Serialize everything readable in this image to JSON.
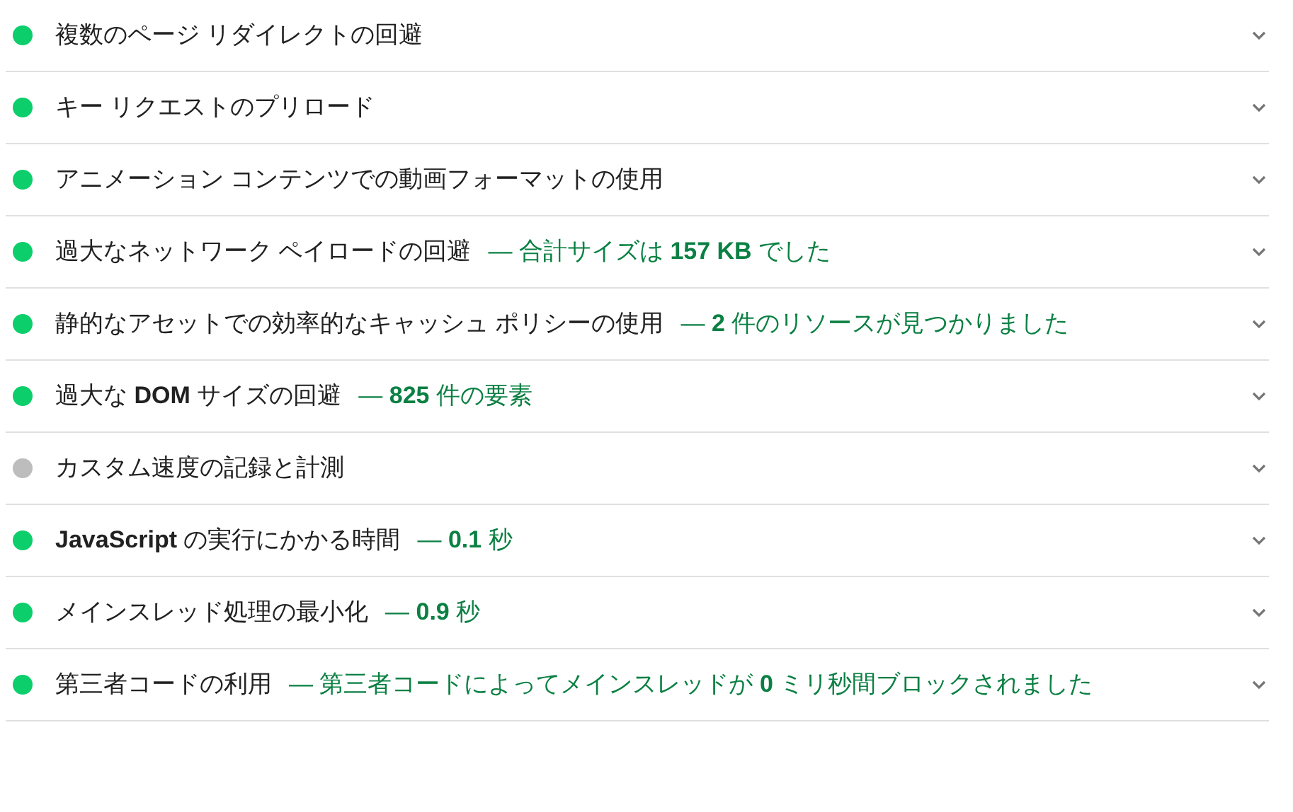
{
  "audits": [
    {
      "title": "複数のページ リダイレクトの回避",
      "color": "#0cce6b"
    },
    {
      "title": "キー リクエストのプリロード",
      "color": "#0cce6b"
    },
    {
      "title": "アニメーション コンテンツでの動画フォーマットの使用",
      "color": "#0cce6b"
    },
    {
      "title": "過大なネットワーク ペイロードの回避",
      "display": "— 合計サイズは **157 KB** でした",
      "color": "#0cce6b"
    },
    {
      "title": "静的なアセットでの効率的なキャッシュ ポリシーの使用",
      "display": "— **2** 件のリソースが見つかりました",
      "color": "#0cce6b"
    },
    {
      "title": "過大な **DOM** サイズの回避",
      "display": "— **825** 件の要素",
      "color": "#0cce6b"
    },
    {
      "title": "カスタム速度の記録と計測",
      "color": "#bdbdbd"
    },
    {
      "title": "**JavaScript** の実行にかかる時間",
      "display": "— **0.1** 秒",
      "color": "#0cce6b"
    },
    {
      "title": "メインスレッド処理の最小化",
      "display": "— **0.9** 秒",
      "color": "#0cce6b"
    },
    {
      "title": "第三者コードの利用",
      "display": "— 第三者コードによってメインスレッドが **0** ミリ秒間ブロックされました",
      "color": "#0cce6b"
    }
  ]
}
